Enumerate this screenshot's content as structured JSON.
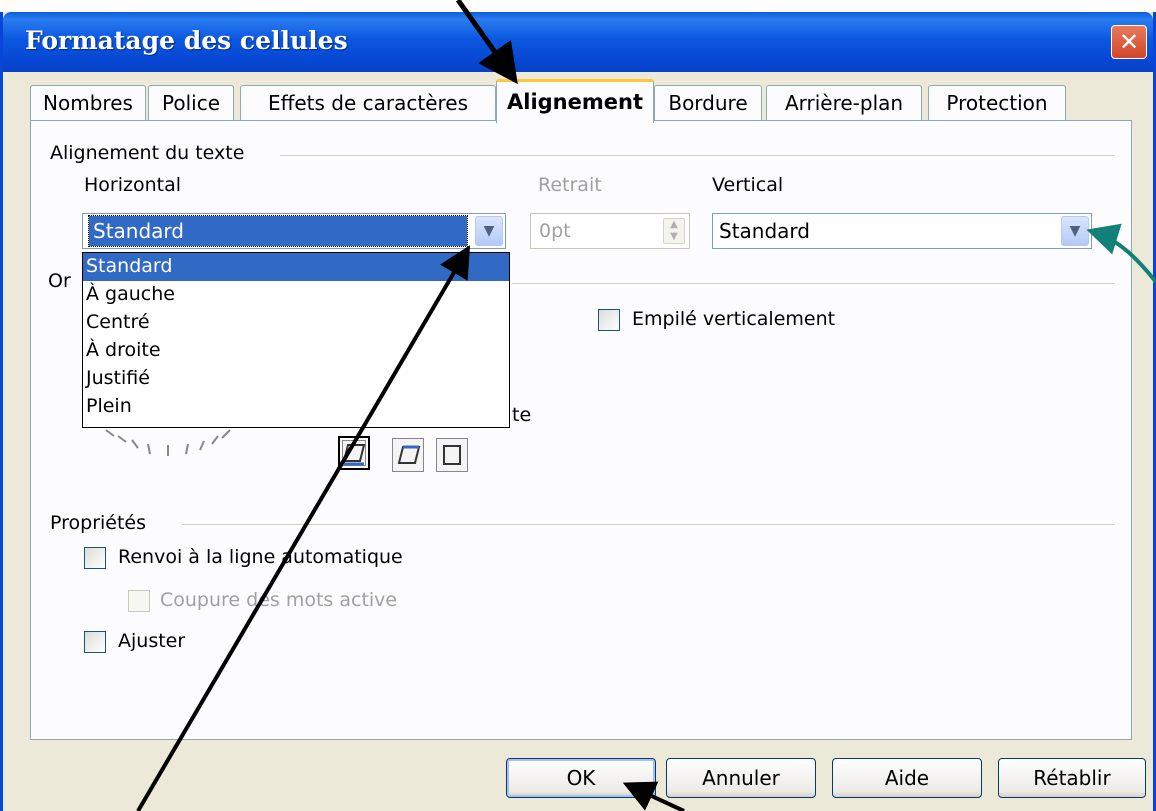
{
  "dialog": {
    "title": "Formatage des cellules"
  },
  "tabs": [
    {
      "label": "Nombres"
    },
    {
      "label": "Police"
    },
    {
      "label": "Effets de caractères"
    },
    {
      "label": "Alignement",
      "active": true
    },
    {
      "label": "Bordure"
    },
    {
      "label": "Arrière-plan"
    },
    {
      "label": "Protection"
    }
  ],
  "text_alignment": {
    "section_label": "Alignement du texte",
    "horizontal_label": "Horizontal",
    "horizontal_value": "Standard",
    "indent_label": "Retrait",
    "indent_value": "0pt",
    "vertical_label": "Vertical",
    "vertical_value": "Standard"
  },
  "horizontal_options": [
    "Standard",
    "À gauche",
    "Centré",
    "À droite",
    "Justifié",
    "Plein"
  ],
  "orientation": {
    "section_label_partial": "Or",
    "partial_text": "te",
    "stacked_label": "Empilé verticalement"
  },
  "properties": {
    "section_label": "Propriétés",
    "wrap_label": "Renvoi à la ligne automatique",
    "hyphenation_label": "Coupure des mots active",
    "shrink_label": "Ajuster"
  },
  "buttons": {
    "ok": "OK",
    "cancel": "Annuler",
    "help": "Aide",
    "reset": "Rétablir"
  },
  "icons": {
    "close": "close-icon",
    "dropdown": "chevron-down-icon",
    "spin": "spin-arrows-icon"
  },
  "colors": {
    "titlebar": "#0a5fdd",
    "selection": "#316ac5",
    "dialog_bg": "#ece9d8",
    "annotation_arrow": "#000000",
    "annotation_teal": "#108078"
  }
}
